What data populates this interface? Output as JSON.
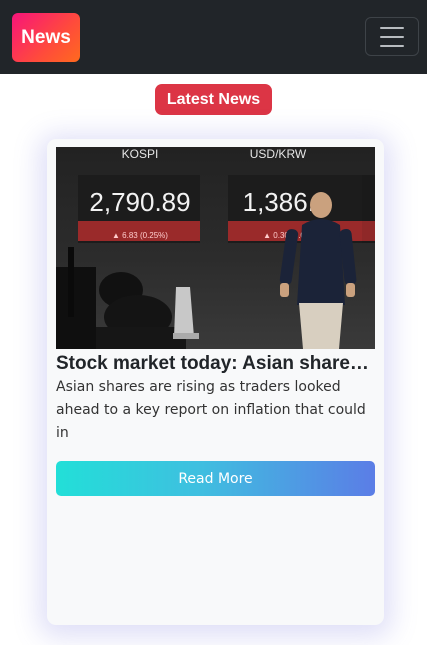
{
  "navbar": {
    "brand": "News",
    "toggler_icon": "hamburger-icon"
  },
  "heading": {
    "label": "Latest News",
    "color": "#dc3545"
  },
  "article": {
    "image": {
      "board_left_label": "KOSPI",
      "board_left_value": "2,790.89",
      "board_left_change": "▲ 6.83 (0.25%)",
      "board_right_label": "USD/KRW",
      "board_right_value": "1,386.1",
      "board_right_change": "▲ 0.30 (0.0"
    },
    "title": "Stock market today: Asian shares ...",
    "summary": "Asian shares are rising as traders looked ahead to a key report on inflation that could in",
    "button_label": "Read More"
  },
  "colors": {
    "navbar_bg": "#212529",
    "brand_gradient": [
      "#f7147a",
      "#ff6a1e"
    ],
    "button_gradient": [
      "#22dfd8",
      "#5b7de6"
    ]
  }
}
